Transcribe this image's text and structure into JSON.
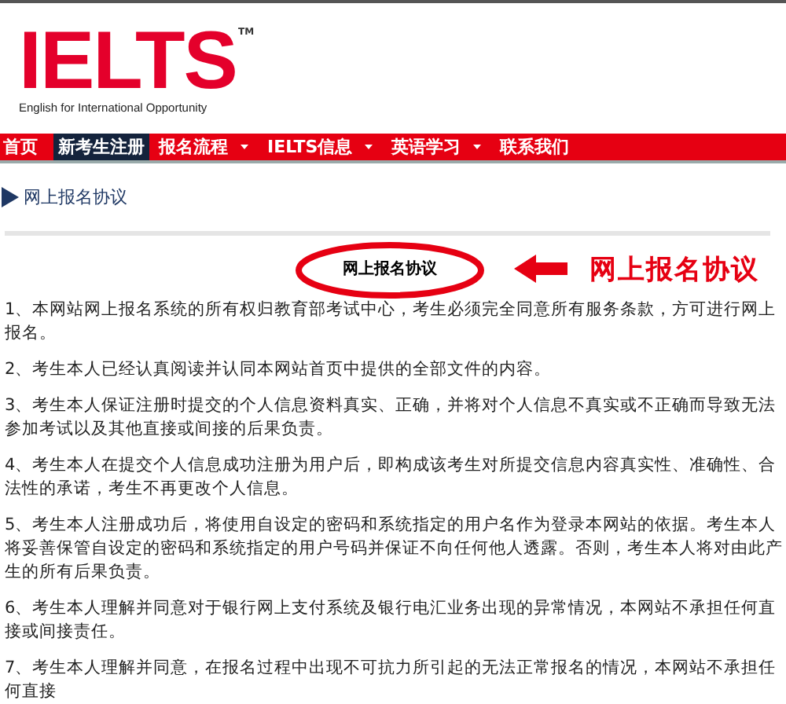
{
  "logo": {
    "wordmark": "IELTS",
    "trademark": "TM",
    "tagline": "English for International Opportunity"
  },
  "nav": [
    {
      "label": "首页",
      "selected": false,
      "has_menu": false
    },
    {
      "label": "新考生注册",
      "selected": true,
      "has_menu": false
    },
    {
      "label": "报名流程",
      "selected": false,
      "has_menu": true
    },
    {
      "label": "IELTS信息",
      "selected": false,
      "has_menu": true
    },
    {
      "label": "英语学习",
      "selected": false,
      "has_menu": true
    },
    {
      "label": "联系我们",
      "selected": false,
      "has_menu": false
    }
  ],
  "section_heading": "网上报名协议",
  "agreement": {
    "title": "网上报名协议",
    "annotation": "网上报名协议",
    "clauses": [
      "1、本网站网上报名系统的所有权归教育部考试中心，考生必须完全同意所有服务条款，方可进行网上报名。",
      "2、考生本人已经认真阅读并认同本网站首页中提供的全部文件的内容。",
      "3、考生本人保证注册时提交的个人信息资料真实、正确，并将对个人信息不真实或不正确而导致无法参加考试以及其他直接或间接的后果负责。",
      "4、考生本人在提交个人信息成功注册为用户后，即构成该考生对所提交信息内容真实性、准确性、合法性的承诺，考生不再更改个人信息。",
      "5、考生本人注册成功后，将使用自设定的密码和系统指定的用户名作为登录本网站的依据。考生本人将妥善保管自设定的密码和系统指定的用户号码并保证不向任何他人透露。否则，考生本人将对由此产生的所有后果负责。",
      "6、考生本人理解并同意对于银行网上支付系统及银行电汇业务出现的异常情况，本网站不承担任何直接或间接责任。",
      "7、考生本人理解并同意，在报名过程中出现不可抗力所引起的无法正常报名的情况，本网站不承担任何直接"
    ]
  }
}
